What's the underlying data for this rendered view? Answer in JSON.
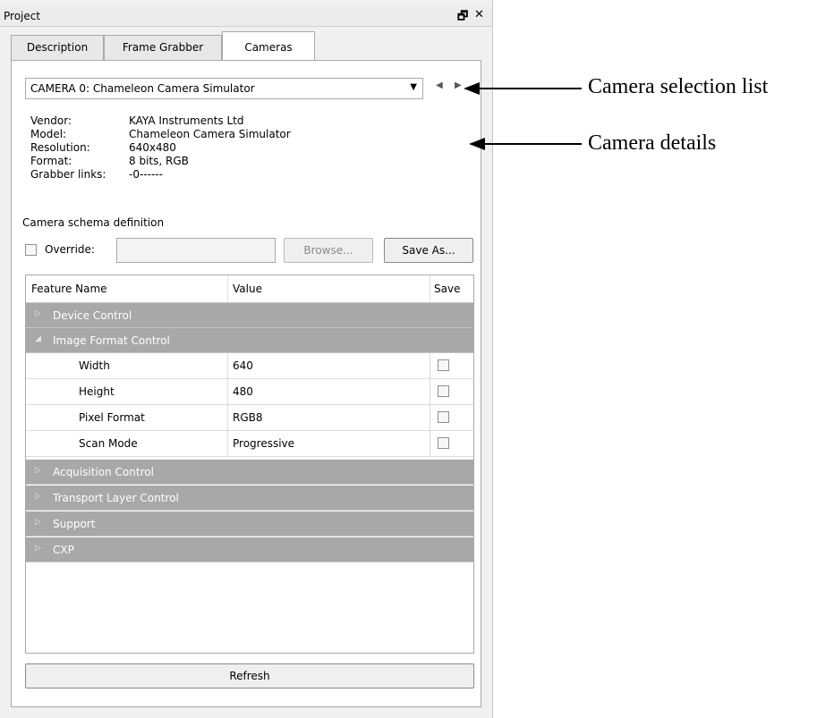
{
  "panel": {
    "title": "Project",
    "dock_glyph": "🗗",
    "close_glyph": "✕"
  },
  "tabs": [
    {
      "label": "Description",
      "active": false
    },
    {
      "label": "Frame Grabber",
      "active": false
    },
    {
      "label": "Cameras",
      "active": true
    }
  ],
  "camera": {
    "selected": "CAMERA 0: Chameleon Camera Simulator",
    "details": [
      {
        "key": "Vendor:",
        "value": "KAYA Instruments Ltd"
      },
      {
        "key": "Model:",
        "value": "Chameleon Camera Simulator"
      },
      {
        "key": "Resolution:",
        "value": "640x480"
      },
      {
        "key": "Format:",
        "value": "8 bits, RGB"
      },
      {
        "key": "Grabber links:",
        "value": "-0------"
      }
    ]
  },
  "schema": {
    "heading": "Camera schema definition",
    "override_label": "Override:",
    "override_checked": false,
    "path_value": "",
    "browse_label": "Browse...",
    "saveas_label": "Save As..."
  },
  "table": {
    "headers": {
      "name": "Feature Name",
      "value": "Value",
      "save": "Save"
    },
    "groups": [
      {
        "label": "Device Control",
        "expanded": false
      },
      {
        "label": "Image Format Control",
        "expanded": true,
        "rows": [
          {
            "name": "Width",
            "value": "640",
            "save": false
          },
          {
            "name": "Height",
            "value": "480",
            "save": false
          },
          {
            "name": "Pixel Format",
            "value": "RGB8",
            "save": false
          },
          {
            "name": "Scan Mode",
            "value": "Progressive",
            "save": false
          }
        ]
      },
      {
        "label": "Acquisition Control",
        "expanded": false
      },
      {
        "label": "Transport Layer Control",
        "expanded": false
      },
      {
        "label": "Support",
        "expanded": false
      },
      {
        "label": "CXP",
        "expanded": false
      }
    ]
  },
  "refresh_label": "Refresh",
  "annotations": {
    "selection": "Camera selection list",
    "details": "Camera details"
  },
  "colors": {
    "group_row_bg": "#a8a8a8",
    "panel_bg": "#f0f0f0"
  }
}
